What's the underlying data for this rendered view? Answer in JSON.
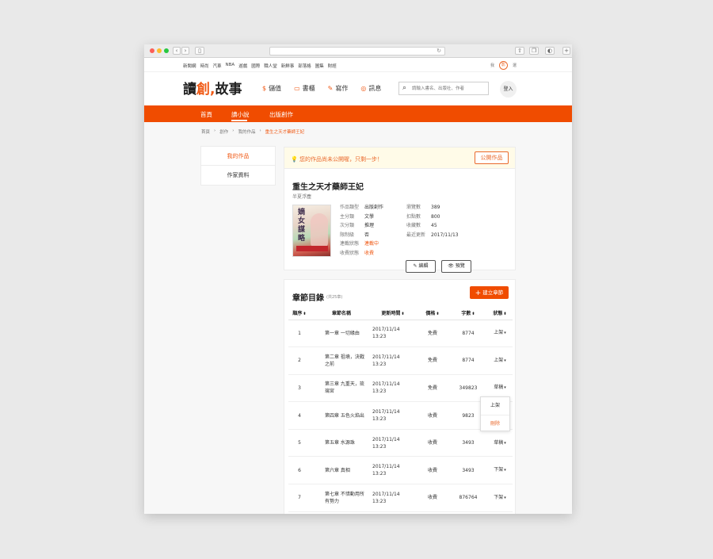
{
  "topnav": {
    "links": [
      "新聞網",
      "時尚",
      "汽車",
      "NBA",
      "遊戲",
      "國際",
      "職人堂",
      "新鮮事",
      "部落格",
      "圖集",
      "財經"
    ],
    "right": [
      "我",
      "影",
      "選"
    ]
  },
  "header": {
    "logo_main": "讀",
    "logo_accent": "創",
    "logo_tail": "故事",
    "nav": [
      {
        "icon": "$",
        "label": "儲值"
      },
      {
        "icon": "▭",
        "label": "書櫃"
      },
      {
        "icon": "✎",
        "label": "寫作"
      },
      {
        "icon": "◎",
        "label": "訊息"
      }
    ],
    "search_placeholder": "請輸入書名、出版社、作者",
    "login": "登入"
  },
  "orange_nav": [
    "首頁",
    "讀小說",
    "出版創作"
  ],
  "breadcrumb": [
    "首頁",
    "創作",
    "我的作品",
    "重生之天才藥師王妃"
  ],
  "sidebar": [
    "我的作品",
    "作家資料"
  ],
  "notice": {
    "text": "您的作品尚未公開喔，只剩一步！",
    "button": "公開作品"
  },
  "work": {
    "title": "重生之天才藥師王妃",
    "author": "半夏浮塵",
    "meta_left": [
      {
        "k": "作品類型",
        "v": "出版創作"
      },
      {
        "k": "主分類",
        "v": "文學"
      },
      {
        "k": "次分類",
        "v": "推理"
      },
      {
        "k": "限制級",
        "v": "否"
      },
      {
        "k": "連載狀態",
        "v": "連載中"
      },
      {
        "k": "收費狀態",
        "v": "收費"
      }
    ],
    "meta_right": [
      {
        "k": "瀏覽數",
        "v": "389"
      },
      {
        "k": "扣點數",
        "v": "800"
      },
      {
        "k": "收藏數",
        "v": "45"
      },
      {
        "k": "最近更新",
        "v": "2017/11/13"
      }
    ],
    "edit_label": "編輯",
    "preview_label": "預覽",
    "cover_text": "嫡女謀略"
  },
  "chapters": {
    "title": "章節目錄",
    "count": "(共25章)",
    "new_button": "建立章節",
    "headers": [
      "順序",
      "章節名稱",
      "更新時間",
      "價格",
      "字數",
      "狀態"
    ],
    "rows": [
      {
        "no": "1",
        "name": "第一章 一切緣由",
        "date": "2017/11/14",
        "time": "13:23",
        "price": "免費",
        "words": "8774",
        "status": "上架"
      },
      {
        "no": "2",
        "name": "第二章 祖墳，決戰之前",
        "date": "2017/11/14",
        "time": "13:23",
        "price": "免費",
        "words": "8774",
        "status": "上架"
      },
      {
        "no": "3",
        "name": "第三章 九重天，琉璃宮",
        "date": "2017/11/14",
        "time": "13:23",
        "price": "免費",
        "words": "349823",
        "status": "草稿"
      },
      {
        "no": "4",
        "name": "第四章 五色火焰出",
        "date": "2017/11/14",
        "time": "13:23",
        "price": "收費",
        "words": "9823",
        "status": ""
      },
      {
        "no": "5",
        "name": "第五章 水源珠",
        "date": "2017/11/14",
        "time": "13:23",
        "price": "收費",
        "words": "3493",
        "status": "草稿"
      },
      {
        "no": "6",
        "name": "第六章 真相",
        "date": "2017/11/14",
        "time": "13:23",
        "price": "收費",
        "words": "3493",
        "status": "下架"
      },
      {
        "no": "7",
        "name": "第七章 不惜動用所有勢力",
        "date": "2017/11/14",
        "time": "13:23",
        "price": "收費",
        "words": "876764",
        "status": "下架"
      }
    ],
    "dropdown": [
      "上架",
      "刪除"
    ]
  }
}
